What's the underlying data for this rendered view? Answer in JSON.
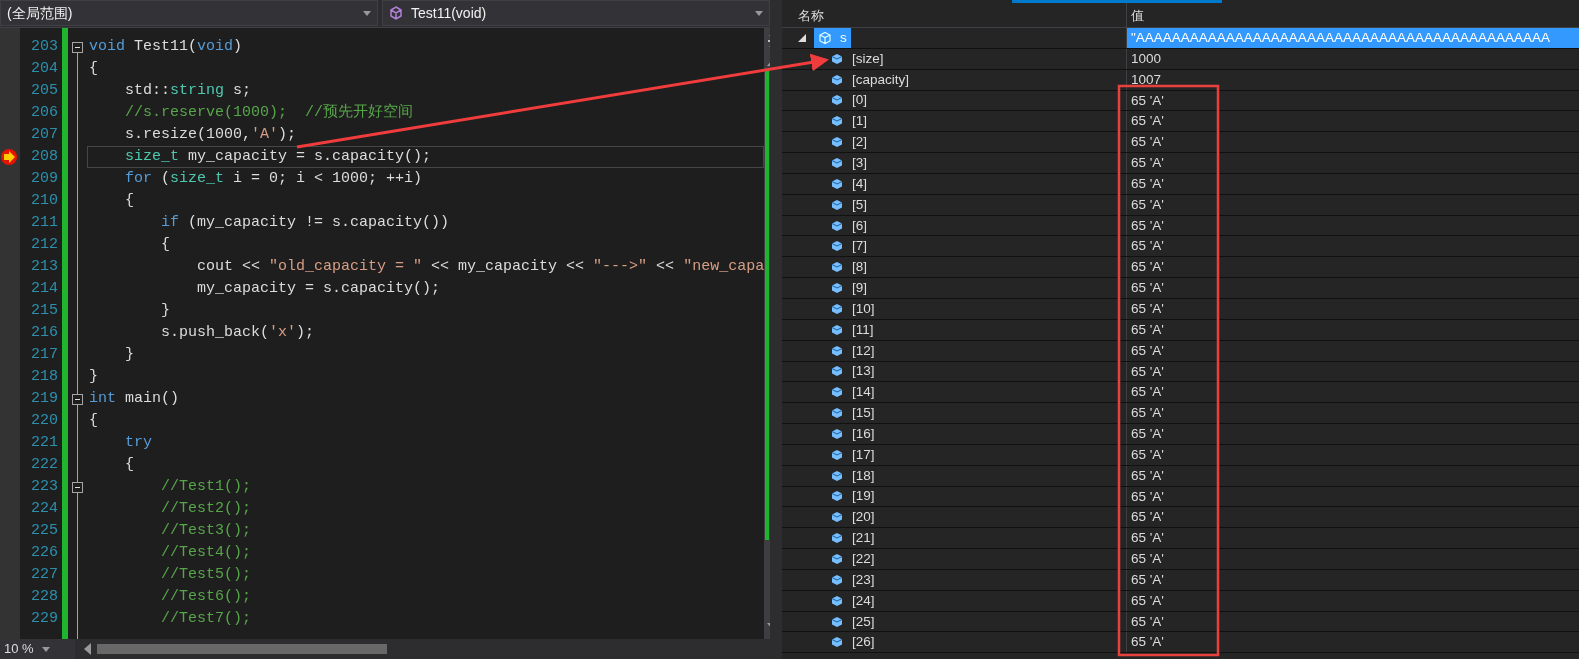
{
  "navigation_bar": {
    "scope": "(全局范围)",
    "function": "Test11(void)"
  },
  "editor": {
    "zoom": "10 %",
    "lines": [
      {
        "number": "203",
        "fold": true,
        "current": false,
        "tokens": [
          {
            "kind": "keyword",
            "text": "void"
          },
          {
            "kind": "plain",
            "text": " Test11("
          },
          {
            "kind": "keyword",
            "text": "void"
          },
          {
            "kind": "plain",
            "text": ")"
          }
        ]
      },
      {
        "number": "204",
        "fold": false,
        "current": false,
        "tokens": [
          {
            "kind": "plain",
            "text": "{"
          }
        ]
      },
      {
        "number": "205",
        "fold": false,
        "current": false,
        "tokens": [
          {
            "kind": "plain",
            "text": "    std::"
          },
          {
            "kind": "type",
            "text": "string"
          },
          {
            "kind": "plain",
            "text": " s;"
          }
        ]
      },
      {
        "number": "206",
        "fold": false,
        "current": false,
        "tokens": [
          {
            "kind": "comment",
            "text": "    //s.reserve(1000);  //预先开好空间"
          }
        ]
      },
      {
        "number": "207",
        "fold": false,
        "current": false,
        "tokens": [
          {
            "kind": "plain",
            "text": "    s.resize(1000,"
          },
          {
            "kind": "string",
            "text": "'A'"
          },
          {
            "kind": "plain",
            "text": ");"
          }
        ]
      },
      {
        "number": "208",
        "fold": false,
        "current": true,
        "tokens": [
          {
            "kind": "type",
            "text": "    size_t"
          },
          {
            "kind": "plain",
            "text": " my_capacity = s.capacity();"
          }
        ]
      },
      {
        "number": "209",
        "fold": false,
        "current": false,
        "tokens": [
          {
            "kind": "keyword",
            "text": "    for"
          },
          {
            "kind": "plain",
            "text": " ("
          },
          {
            "kind": "type",
            "text": "size_t"
          },
          {
            "kind": "plain",
            "text": " i = 0; i < 1000; ++i)"
          }
        ]
      },
      {
        "number": "210",
        "fold": false,
        "current": false,
        "tokens": [
          {
            "kind": "plain",
            "text": "    {"
          }
        ]
      },
      {
        "number": "211",
        "fold": false,
        "current": false,
        "tokens": [
          {
            "kind": "keyword",
            "text": "        if"
          },
          {
            "kind": "plain",
            "text": " (my_capacity != s.capacity())"
          }
        ]
      },
      {
        "number": "212",
        "fold": false,
        "current": false,
        "tokens": [
          {
            "kind": "plain",
            "text": "        {"
          }
        ]
      },
      {
        "number": "213",
        "fold": false,
        "current": false,
        "tokens": [
          {
            "kind": "plain",
            "text": "            cout << "
          },
          {
            "kind": "string",
            "text": "\"old_capacity = \""
          },
          {
            "kind": "plain",
            "text": " << my_capacity << "
          },
          {
            "kind": "string",
            "text": "\"--->\""
          },
          {
            "kind": "plain",
            "text": " << "
          },
          {
            "kind": "string",
            "text": "\"new_capa"
          }
        ]
      },
      {
        "number": "214",
        "fold": false,
        "current": false,
        "tokens": [
          {
            "kind": "plain",
            "text": "            my_capacity = s.capacity();"
          }
        ]
      },
      {
        "number": "215",
        "fold": false,
        "current": false,
        "tokens": [
          {
            "kind": "plain",
            "text": "        }"
          }
        ]
      },
      {
        "number": "216",
        "fold": false,
        "current": false,
        "tokens": [
          {
            "kind": "plain",
            "text": "        s.push_back("
          },
          {
            "kind": "string",
            "text": "'x'"
          },
          {
            "kind": "plain",
            "text": ");"
          }
        ]
      },
      {
        "number": "217",
        "fold": false,
        "current": false,
        "tokens": [
          {
            "kind": "plain",
            "text": "    }"
          }
        ]
      },
      {
        "number": "218",
        "fold": false,
        "current": false,
        "tokens": [
          {
            "kind": "plain",
            "text": "}"
          }
        ]
      },
      {
        "number": "219",
        "fold": true,
        "current": false,
        "tokens": [
          {
            "kind": "keyword",
            "text": "int"
          },
          {
            "kind": "plain",
            "text": " main()"
          }
        ]
      },
      {
        "number": "220",
        "fold": false,
        "current": false,
        "tokens": [
          {
            "kind": "plain",
            "text": "{"
          }
        ]
      },
      {
        "number": "221",
        "fold": false,
        "current": false,
        "tokens": [
          {
            "kind": "keyword",
            "text": "    try"
          }
        ]
      },
      {
        "number": "222",
        "fold": false,
        "current": false,
        "tokens": [
          {
            "kind": "plain",
            "text": "    {"
          }
        ]
      },
      {
        "number": "223",
        "fold": true,
        "current": false,
        "tokens": [
          {
            "kind": "comment",
            "text": "        //Test1();"
          }
        ]
      },
      {
        "number": "224",
        "fold": false,
        "current": false,
        "tokens": [
          {
            "kind": "comment",
            "text": "        //Test2();"
          }
        ]
      },
      {
        "number": "225",
        "fold": false,
        "current": false,
        "tokens": [
          {
            "kind": "comment",
            "text": "        //Test3();"
          }
        ]
      },
      {
        "number": "226",
        "fold": false,
        "current": false,
        "tokens": [
          {
            "kind": "comment",
            "text": "        //Test4();"
          }
        ]
      },
      {
        "number": "227",
        "fold": false,
        "current": false,
        "tokens": [
          {
            "kind": "comment",
            "text": "        //Test5();"
          }
        ]
      },
      {
        "number": "228",
        "fold": false,
        "current": false,
        "tokens": [
          {
            "kind": "comment",
            "text": "        //Test6();"
          }
        ]
      },
      {
        "number": "229",
        "fold": false,
        "current": false,
        "tokens": [
          {
            "kind": "comment",
            "text": "        //Test7();"
          }
        ]
      }
    ]
  },
  "watch": {
    "columns": [
      "名称",
      "值"
    ],
    "rows": [
      {
        "name": "s",
        "value": "\"AAAAAAAAAAAAAAAAAAAAAAAAAAAAAAAAAAAAAAAAAAAAAA",
        "expanded": true,
        "selected": true,
        "children": [
          {
            "name": "[size]",
            "value": "1000",
            "selected": false
          },
          {
            "name": "[capacity]",
            "value": "1007",
            "selected": false
          },
          {
            "name": "[0]",
            "value": "65 'A'",
            "selected": false
          },
          {
            "name": "[1]",
            "value": "65 'A'",
            "selected": false
          },
          {
            "name": "[2]",
            "value": "65 'A'",
            "selected": false
          },
          {
            "name": "[3]",
            "value": "65 'A'",
            "selected": false
          },
          {
            "name": "[4]",
            "value": "65 'A'",
            "selected": false
          },
          {
            "name": "[5]",
            "value": "65 'A'",
            "selected": false
          },
          {
            "name": "[6]",
            "value": "65 'A'",
            "selected": false
          },
          {
            "name": "[7]",
            "value": "65 'A'",
            "selected": false
          },
          {
            "name": "[8]",
            "value": "65 'A'",
            "selected": false
          },
          {
            "name": "[9]",
            "value": "65 'A'",
            "selected": false
          },
          {
            "name": "[10]",
            "value": "65 'A'",
            "selected": false
          },
          {
            "name": "[11]",
            "value": "65 'A'",
            "selected": false
          },
          {
            "name": "[12]",
            "value": "65 'A'",
            "selected": false
          },
          {
            "name": "[13]",
            "value": "65 'A'",
            "selected": false
          },
          {
            "name": "[14]",
            "value": "65 'A'",
            "selected": false
          },
          {
            "name": "[15]",
            "value": "65 'A'",
            "selected": false
          },
          {
            "name": "[16]",
            "value": "65 'A'",
            "selected": false
          },
          {
            "name": "[17]",
            "value": "65 'A'",
            "selected": false
          },
          {
            "name": "[18]",
            "value": "65 'A'",
            "selected": false
          },
          {
            "name": "[19]",
            "value": "65 'A'",
            "selected": false
          },
          {
            "name": "[20]",
            "value": "65 'A'",
            "selected": false
          },
          {
            "name": "[21]",
            "value": "65 'A'",
            "selected": false
          },
          {
            "name": "[22]",
            "value": "65 'A'",
            "selected": false
          },
          {
            "name": "[23]",
            "value": "65 'A'",
            "selected": false
          },
          {
            "name": "[24]",
            "value": "65 'A'",
            "selected": false
          },
          {
            "name": "[25]",
            "value": "65 'A'",
            "selected": false
          },
          {
            "name": "[26]",
            "value": "65 'A'",
            "selected": false
          }
        ]
      }
    ]
  }
}
